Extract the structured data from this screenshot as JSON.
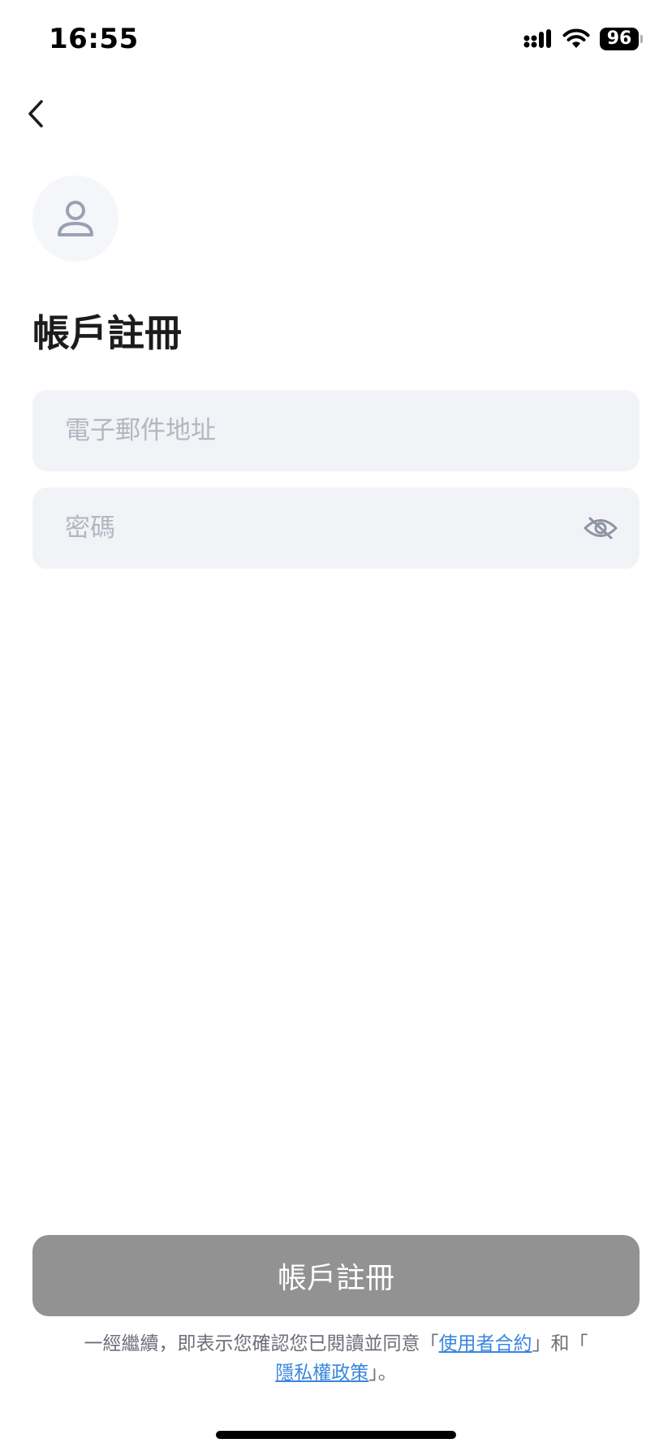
{
  "status_bar": {
    "time": "16:55",
    "battery_level": "96",
    "icons": [
      "signal-icon",
      "wifi-icon",
      "battery-icon"
    ]
  },
  "nav": {
    "back_icon": "chevron-left-icon"
  },
  "avatar": {
    "icon": "user-icon"
  },
  "page": {
    "title": "帳戶註冊"
  },
  "form": {
    "email_placeholder": "電子郵件地址",
    "email_value": "",
    "password_placeholder": "密碼",
    "password_value": "",
    "password_toggle_icon": "eye-slash-icon"
  },
  "actions": {
    "register_label": "帳戶註冊"
  },
  "terms": {
    "prefix": "一經繼續，即表示您確認您已閱讀並同意「",
    "user_agreement": "使用者合約",
    "middle": "」和「",
    "privacy_policy": "隱私權政策",
    "suffix": "」。"
  },
  "colors": {
    "link": "#3a86de",
    "button_disabled": "#929292",
    "field_background": "#f2f3f7",
    "placeholder": "#b3b7c2"
  }
}
